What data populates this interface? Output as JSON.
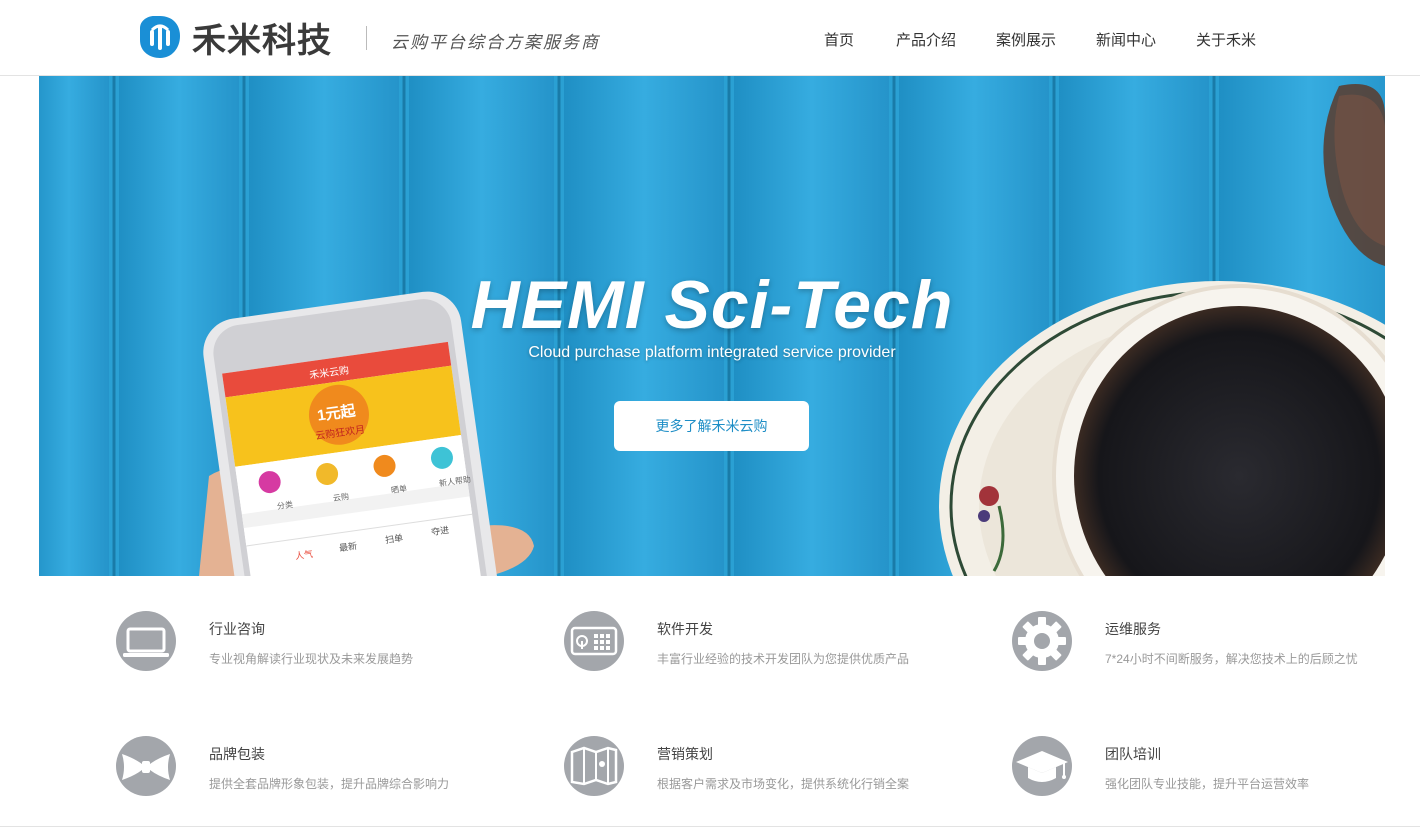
{
  "header": {
    "logo_text": "禾米科技",
    "slogan": "云购平台综合方案服务商",
    "nav": [
      "首页",
      "产品介绍",
      "案例展示",
      "新闻中心",
      "关于禾米"
    ]
  },
  "hero": {
    "title": "HEMI Sci-Tech",
    "subtitle": "Cloud purchase platform integrated service provider",
    "button_label": "更多了解禾米云购",
    "phone": {
      "app_title": "禾米云购",
      "promo_big": "1元起",
      "promo_small": "云购狂欢月",
      "icons": [
        "分类",
        "云购",
        "晒单",
        "新人帮助"
      ],
      "tabs": [
        "人气",
        "最新",
        "扫单",
        "夺进"
      ]
    }
  },
  "services": [
    {
      "title": "行业咨询",
      "desc": "专业视角解读行业现状及未来发展趋势",
      "icon": "laptop-icon"
    },
    {
      "title": "软件开发",
      "desc": "丰富行业经验的技术开发团队为您提供优质产品",
      "icon": "device-icon"
    },
    {
      "title": "运维服务",
      "desc": "7*24小时不间断服务，解决您技术上的后顾之忧",
      "icon": "gear-icon"
    },
    {
      "title": "品牌包装",
      "desc": "提供全套品牌形象包装，提升品牌综合影响力",
      "icon": "bowtie-icon"
    },
    {
      "title": "营销策划",
      "desc": "根据客户需求及市场变化，提供系统化行销全案",
      "icon": "map-icon"
    },
    {
      "title": "团队培训",
      "desc": "强化团队专业技能，提升平台运营效率",
      "icon": "graduation-cap-icon"
    }
  ],
  "colors": {
    "accent": "#1e8ec6",
    "hero_blue": "#2aa0d3",
    "icon_gray": "#a3a6ab",
    "logo_blue": "#1a8fd6"
  }
}
